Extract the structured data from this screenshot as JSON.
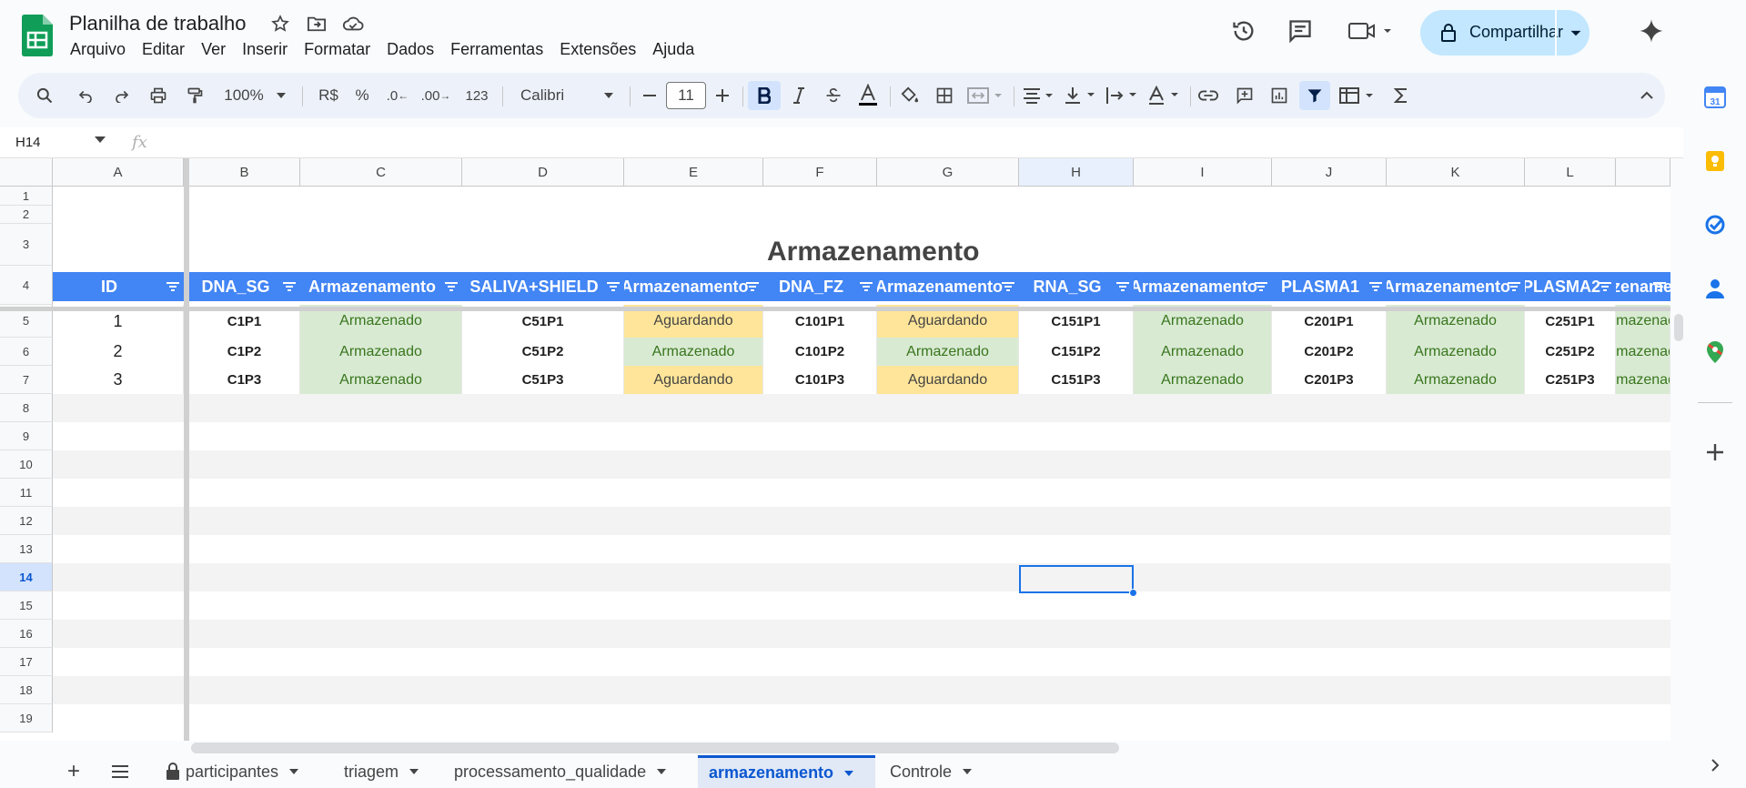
{
  "app": {
    "doc_title": "Planilha de trabalho",
    "menu": [
      "Arquivo",
      "Editar",
      "Ver",
      "Inserir",
      "Formatar",
      "Dados",
      "Ferramentas",
      "Extensões",
      "Ajuda"
    ],
    "share_label": "Compartilhar"
  },
  "toolbar": {
    "zoom": "100%",
    "currency": "R$",
    "percent": "%",
    "dec_decrease": ".0",
    "dec_increase": ".00",
    "number_format": "123",
    "font": "Calibri",
    "font_size": "11"
  },
  "formula_bar": {
    "name_box": "H14",
    "fx": "fx",
    "content": ""
  },
  "grid": {
    "columns": [
      "A",
      "B",
      "C",
      "D",
      "E",
      "F",
      "G",
      "H",
      "I",
      "J",
      "K",
      "L"
    ],
    "selected_column": "H",
    "rows": [
      "1",
      "2",
      "3",
      "4",
      "5",
      "6",
      "7",
      "8",
      "9",
      "10",
      "11",
      "12",
      "13",
      "14",
      "15",
      "16",
      "17",
      "18",
      "19"
    ],
    "selected_row": "14",
    "title": "Armazenamento",
    "headers": [
      "ID",
      "DNA_SG",
      "Armazenamento",
      "SALIVA+SHIELD",
      "Armazenamento",
      "DNA_FZ",
      "Armazenamento",
      "RNA_SG",
      "Armazenamento",
      "PLASMA1",
      "Armazenamento",
      "PLASMA2",
      "Armazenamento"
    ],
    "data": [
      [
        "1",
        "C1P1",
        "Armazenado",
        "C51P1",
        "Aguardando",
        "C101P1",
        "Aguardando",
        "C151P1",
        "Armazenado",
        "C201P1",
        "Armazenado",
        "C251P1",
        "Armazenado"
      ],
      [
        "2",
        "C1P2",
        "Armazenado",
        "C51P2",
        "Armazenado",
        "C101P2",
        "Armazenado",
        "C151P2",
        "Armazenado",
        "C201P2",
        "Armazenado",
        "C251P2",
        "Armazenado"
      ],
      [
        "3",
        "C1P3",
        "Armazenado",
        "C51P3",
        "Aguardando",
        "C101P3",
        "Aguardando",
        "C151P3",
        "Armazenado",
        "C201P3",
        "Armazenado",
        "C251P3",
        "Armazenado"
      ]
    ]
  },
  "colors": {
    "header_blue": "#4285f4",
    "stored_bg": "#d9ead3",
    "stored_fg": "#38761d",
    "waiting_bg": "#ffe599",
    "waiting_fg": "#444444"
  },
  "sheets": [
    {
      "label": "participantes",
      "locked": true,
      "active": false
    },
    {
      "label": "triagem",
      "locked": false,
      "active": false
    },
    {
      "label": "processamento_qualidade",
      "locked": false,
      "active": false
    },
    {
      "label": "armazenamento",
      "locked": false,
      "active": true
    },
    {
      "label": "Controle",
      "locked": false,
      "active": false
    }
  ],
  "side_panel": {
    "calendar_day": "31"
  }
}
